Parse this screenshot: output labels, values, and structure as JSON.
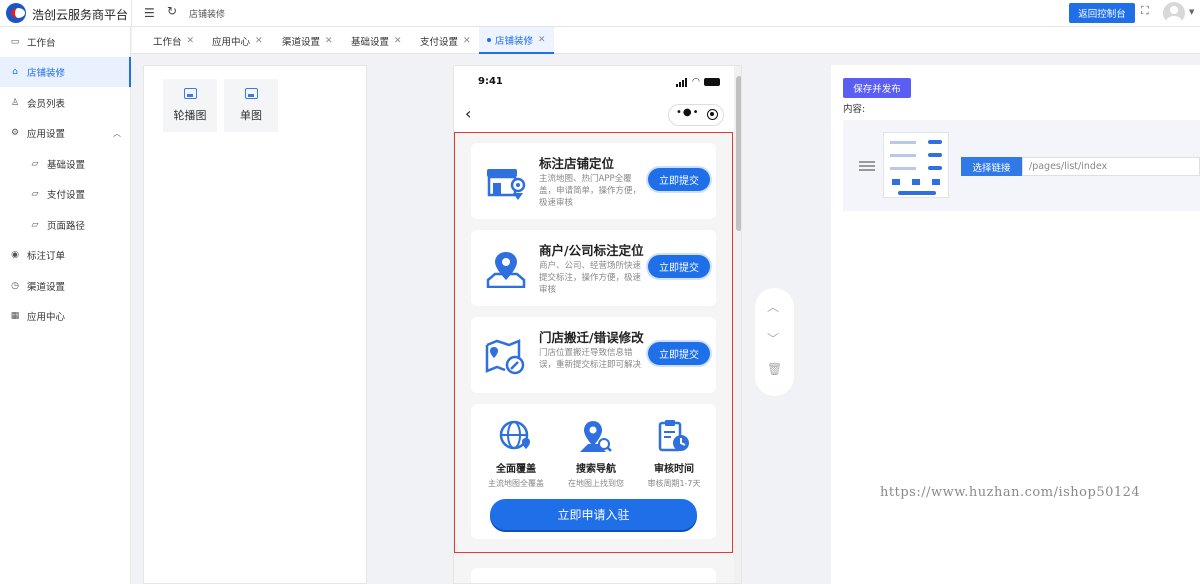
{
  "app": {
    "brand": "浩创云服务商平台",
    "breadcrumb": "店铺装修",
    "back_button": "返回控制台"
  },
  "sidebar": {
    "items": [
      {
        "label": "工作台",
        "icon": "monitor-icon"
      },
      {
        "label": "店铺装修",
        "icon": "shop-icon",
        "active": true
      },
      {
        "label": "会员列表",
        "icon": "user-icon"
      },
      {
        "label": "应用设置",
        "icon": "gear-icon",
        "expanded": true
      },
      {
        "label": "基础设置",
        "icon": "folder-icon"
      },
      {
        "label": "支付设置",
        "icon": "folder-icon"
      },
      {
        "label": "页面路径",
        "icon": "folder-icon"
      },
      {
        "label": "标注订单",
        "icon": "location-icon"
      },
      {
        "label": "渠道设置",
        "icon": "clock-icon"
      },
      {
        "label": "应用中心",
        "icon": "grid-icon"
      }
    ]
  },
  "tabs": [
    {
      "label": "工作台"
    },
    {
      "label": "应用中心"
    },
    {
      "label": "渠道设置"
    },
    {
      "label": "基础设置"
    },
    {
      "label": "支付设置"
    },
    {
      "label": "店铺装修",
      "active": true
    }
  ],
  "components": [
    {
      "label": "轮播图",
      "icon": "image-icon"
    },
    {
      "label": "单图",
      "icon": "image-icon"
    }
  ],
  "phone": {
    "time": "9:41",
    "cards": [
      {
        "title": "标注店铺定位",
        "desc": "主流地图、热门APP全覆盖，申请简单，操作方便，极速审核",
        "button": "立即提交",
        "icon": "store-location-icon"
      },
      {
        "title": "商户/公司标注定位",
        "desc": "商户、公司、经营场所快速提交标注，操作方便，极速审核",
        "button": "立即提交",
        "icon": "map-pin-icon"
      },
      {
        "title": "门店搬迁/错误修改",
        "desc": "门店位置搬迁导致信息错误，重新提交标注即可解决",
        "button": "立即提交",
        "icon": "map-edit-icon"
      }
    ],
    "features": [
      {
        "title": "全面覆盖",
        "sub": "主流地图全覆盖",
        "icon": "globe-icon"
      },
      {
        "title": "搜索导航",
        "sub": "在地图上找到您",
        "icon": "search-nav-icon"
      },
      {
        "title": "审核时间",
        "sub": "审核周期1-7天",
        "icon": "clipboard-clock-icon"
      }
    ],
    "apply_button": "立即申请入驻"
  },
  "right": {
    "publish_button": "保存并发布",
    "content_label": "内容:",
    "choose_link_button": "选择链接",
    "link_path": "/pages/list/index"
  },
  "watermark": "https://www.huzhan.com/ishop50124",
  "colors": {
    "primary": "#1e6fe8",
    "publish": "#5a5ef2",
    "frame": "#e53935"
  }
}
